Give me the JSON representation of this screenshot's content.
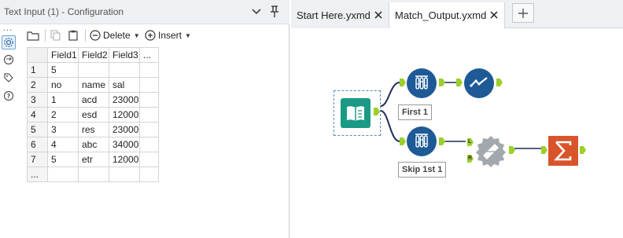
{
  "panel": {
    "title": "Text Input (1) - Configuration",
    "side_dots": "...",
    "toolbar": {
      "delete_label": "Delete",
      "insert_label": "Insert"
    }
  },
  "grid": {
    "headers": [
      "Field1",
      "Field2",
      "Field3",
      "..."
    ],
    "rows": [
      {
        "n": "1",
        "c": [
          "5",
          "",
          "",
          ""
        ]
      },
      {
        "n": "2",
        "c": [
          "no",
          "name",
          "sal",
          ""
        ]
      },
      {
        "n": "3",
        "c": [
          "1",
          "acd",
          "23000",
          ""
        ]
      },
      {
        "n": "4",
        "c": [
          "2",
          "esd",
          "12000",
          ""
        ]
      },
      {
        "n": "5",
        "c": [
          "3",
          "res",
          "23000",
          ""
        ]
      },
      {
        "n": "6",
        "c": [
          "4",
          "abc",
          "34000",
          ""
        ]
      },
      {
        "n": "7",
        "c": [
          "5",
          "etr",
          "12000",
          ""
        ]
      },
      {
        "n": "...",
        "c": [
          "",
          "",
          "",
          ""
        ]
      }
    ]
  },
  "tabs": [
    {
      "label": "Start Here.yxmd",
      "active": false
    },
    {
      "label": "Match_Output.yxmd",
      "active": true
    }
  ],
  "workflow": {
    "tools": [
      {
        "name": "Text Input",
        "icon": "text-input-icon",
        "color": "#1a9a84"
      },
      {
        "name": "Sample First",
        "icon": "sample-icon",
        "color": "#1d5a96",
        "label": "First 1"
      },
      {
        "name": "Browse",
        "icon": "browse-check-icon",
        "color": "#1d5a96"
      },
      {
        "name": "Sample Skip",
        "icon": "sample-icon",
        "color": "#1d5a96",
        "label": "Skip 1st 1"
      },
      {
        "name": "Join",
        "icon": "join-icon",
        "color": "#9ea4a8"
      },
      {
        "name": "Summarize",
        "icon": "summarize-icon",
        "color": "#d9542b"
      }
    ],
    "anchor_labels": {
      "left": "L",
      "right": "R"
    },
    "anchor_color": "#9ccf2a"
  }
}
